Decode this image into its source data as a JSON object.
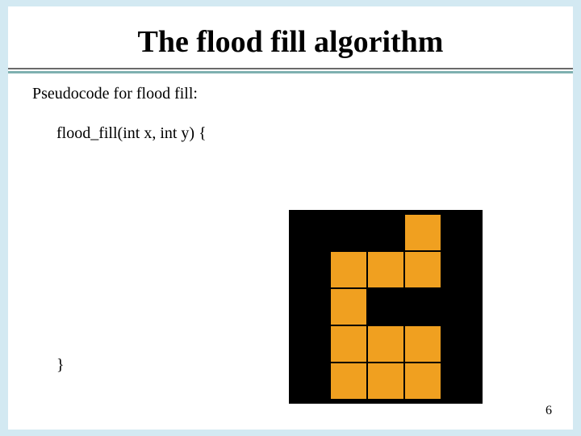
{
  "title": "The flood fill algorithm",
  "intro": "Pseudocode for flood fill:",
  "code_open": "flood_fill(int x, int y) {",
  "code_close": "}",
  "page_number": "6",
  "grid": {
    "rows": 5,
    "cols": 5,
    "cells": [
      [
        0,
        0,
        0,
        1,
        0
      ],
      [
        0,
        1,
        1,
        1,
        0
      ],
      [
        0,
        1,
        0,
        0,
        0
      ],
      [
        0,
        1,
        1,
        1,
        0
      ],
      [
        0,
        1,
        1,
        1,
        0
      ]
    ],
    "colors": {
      "on": "#f0a020",
      "off": "#000000"
    }
  }
}
